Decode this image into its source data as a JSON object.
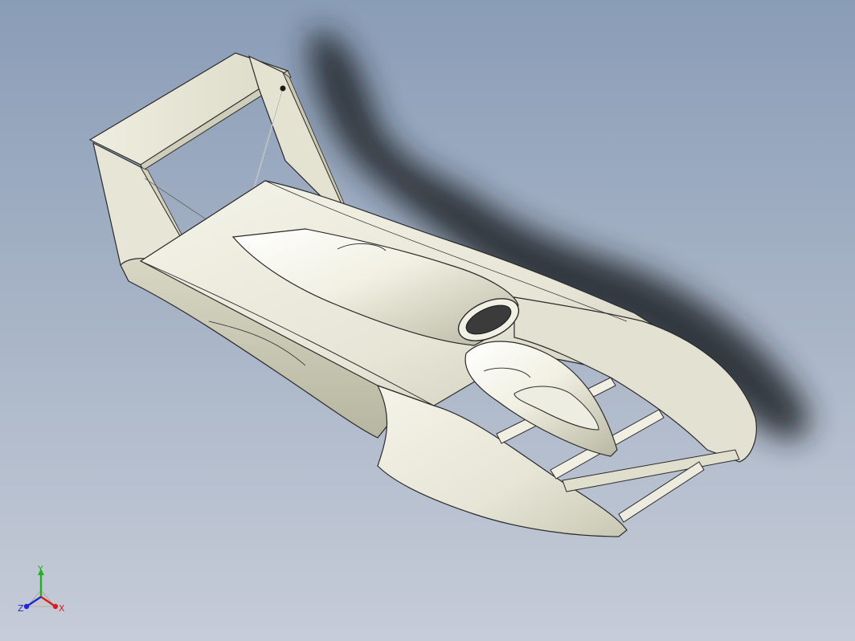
{
  "viewport": {
    "background_top": "#8a9db7",
    "background_bottom": "#c6ccd8"
  },
  "model": {
    "body_color": "#ecebde",
    "edge_color": "#2a2a2a",
    "shadow_color": "#1e2226"
  },
  "triad": {
    "x_label": "X",
    "y_label": "Y",
    "z_label": "Z",
    "x_color": "#d81e1e",
    "y_color": "#1fb31f",
    "z_color": "#2323d8"
  }
}
